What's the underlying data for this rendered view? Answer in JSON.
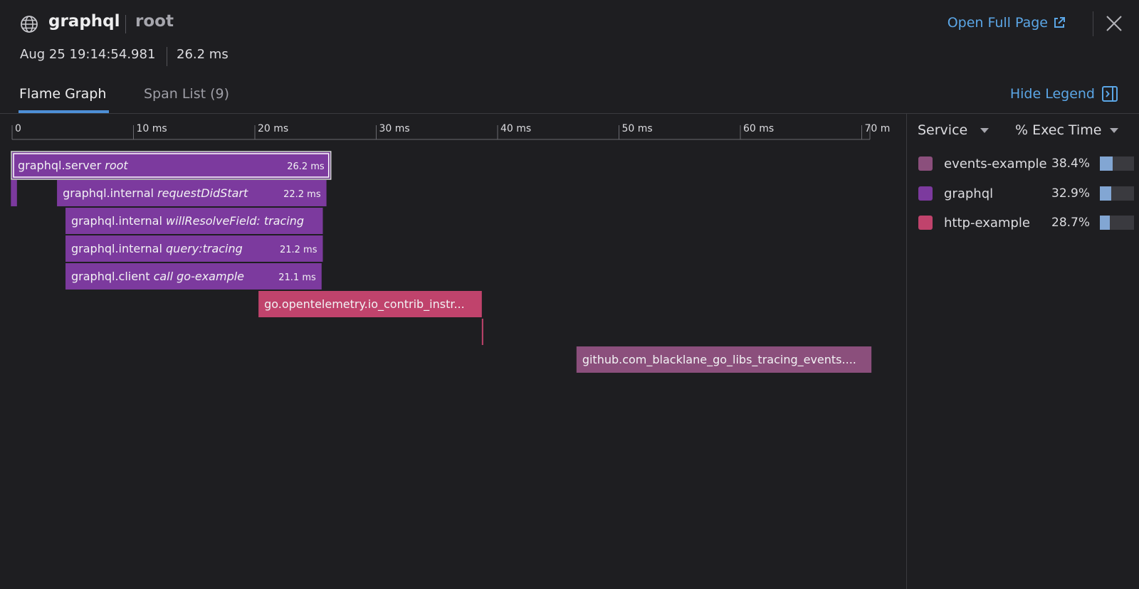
{
  "header": {
    "title": "graphql",
    "subtitle": "root",
    "timestamp": "Aug 25 19:14:54.981",
    "duration": "26.2 ms",
    "open_full_page_label": "Open Full Page"
  },
  "tabs": [
    {
      "label": "Flame Graph",
      "active": true
    },
    {
      "label": "Span List (9)",
      "active": false
    }
  ],
  "hide_legend_label": "Hide Legend",
  "axis": {
    "ticks": [
      {
        "value": 0,
        "label": "0"
      },
      {
        "value": 10,
        "label": "10 ms"
      },
      {
        "value": 20,
        "label": "20 ms"
      },
      {
        "value": 30,
        "label": "30 ms"
      },
      {
        "value": 40,
        "label": "40 ms"
      },
      {
        "value": 50,
        "label": "50 ms"
      },
      {
        "value": 60,
        "label": "60 ms"
      },
      {
        "value": 70,
        "label": "70 m"
      }
    ]
  },
  "services": {
    "events-example": "#8b4f7c",
    "graphql": "#7c3a9e",
    "http-example": "#c0436c"
  },
  "spans": [
    {
      "service": "graphql",
      "name": "graphql.server",
      "resource": "root",
      "duration_label": "26.2 ms",
      "start_ms": 0.0,
      "end_ms": 26.2,
      "depth": 0,
      "selected": true
    },
    {
      "service": "graphql",
      "name": "",
      "resource": "",
      "duration_label": "",
      "start_ms": -0.1,
      "end_ms": 0.4,
      "depth": 1,
      "selected": false
    },
    {
      "service": "graphql",
      "name": "graphql.internal",
      "resource": "requestDidStart",
      "duration_label": "22.2 ms",
      "start_ms": 3.7,
      "end_ms": 25.9,
      "depth": 1,
      "selected": false
    },
    {
      "service": "graphql",
      "name": "graphql.internal",
      "resource": "willResolveField: tracing",
      "duration_label": "",
      "start_ms": 4.4,
      "end_ms": 25.6,
      "depth": 2,
      "selected": false
    },
    {
      "service": "graphql",
      "name": "graphql.internal",
      "resource": "query:tracing",
      "duration_label": "21.2 ms",
      "start_ms": 4.4,
      "end_ms": 25.6,
      "depth": 3,
      "selected": false
    },
    {
      "service": "graphql",
      "name": "graphql.client",
      "resource": "call go-example",
      "duration_label": "21.1 ms",
      "start_ms": 4.4,
      "end_ms": 25.5,
      "depth": 4,
      "selected": false
    },
    {
      "service": "http-example",
      "name": "go.opentelemetry.io_contrib_instr...",
      "resource": "",
      "duration_label": "",
      "start_ms": 20.3,
      "end_ms": 38.7,
      "depth": 5,
      "selected": false
    },
    {
      "service": "http-example",
      "name": "",
      "resource": "",
      "duration_label": "",
      "start_ms": 38.7,
      "end_ms": 38.8,
      "depth": 6,
      "selected": false
    },
    {
      "service": "events-example",
      "name": "github.com_blacklane_go_libs_tracing_events....",
      "resource": "",
      "duration_label": "",
      "start_ms": 46.5,
      "end_ms": 70.8,
      "depth": 7,
      "selected": false
    }
  ],
  "legend": {
    "col_service": "Service",
    "col_exec": "% Exec Time",
    "rows": [
      {
        "name": "events-example",
        "pct_label": "38.4%",
        "pct": 38.4,
        "color": "#8b4f7c"
      },
      {
        "name": "graphql",
        "pct_label": "32.9%",
        "pct": 32.9,
        "color": "#7c3a9e"
      },
      {
        "name": "http-example",
        "pct_label": "28.7%",
        "pct": 28.7,
        "color": "#c0436c"
      }
    ]
  }
}
